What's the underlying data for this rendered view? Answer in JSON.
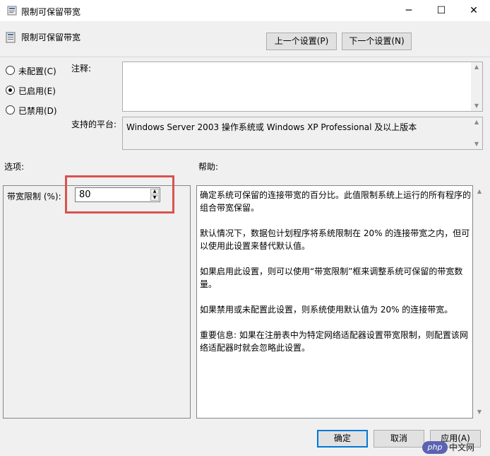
{
  "window": {
    "title": "限制可保留带宽",
    "minimize": "─",
    "maximize": "☐",
    "close": "✕"
  },
  "header": {
    "title": "限制可保留带宽",
    "prev_button": "上一个设置(P)",
    "next_button": "下一个设置(N)"
  },
  "state": {
    "options": [
      {
        "label": "未配置(C)",
        "selected": false
      },
      {
        "label": "已启用(E)",
        "selected": true
      },
      {
        "label": "已禁用(D)",
        "selected": false
      }
    ]
  },
  "comment": {
    "label": "注释:",
    "value": ""
  },
  "platform": {
    "label": "支持的平台:",
    "value": "Windows Server 2003 操作系统或 Windows XP Professional 及以上版本"
  },
  "options_section": {
    "label": "选项:",
    "bandwidth_label": "带宽限制 (%):",
    "bandwidth_value": "80"
  },
  "help_section": {
    "label": "帮助:",
    "paragraphs": [
      "确定系统可保留的连接带宽的百分比。此值限制系统上运行的所有程序的组合带宽保留。",
      "默认情况下，数据包计划程序将系统限制在 20% 的连接带宽之内，但可以使用此设置来替代默认值。",
      "如果启用此设置，则可以使用“带宽限制”框来调整系统可保留的带宽数量。",
      "如果禁用或未配置此设置，则系统使用默认值为 20% 的连接带宽。",
      "重要信息: 如果在注册表中为特定网络适配器设置带宽限制，则配置该网络适配器时就会忽略此设置。"
    ]
  },
  "footer": {
    "ok": "确定",
    "cancel": "取消",
    "apply": "应用(A)"
  },
  "watermark": {
    "logo": "php",
    "text": "中文网"
  },
  "colors": {
    "highlight": "#d9534f",
    "accent": "#0078d7"
  }
}
